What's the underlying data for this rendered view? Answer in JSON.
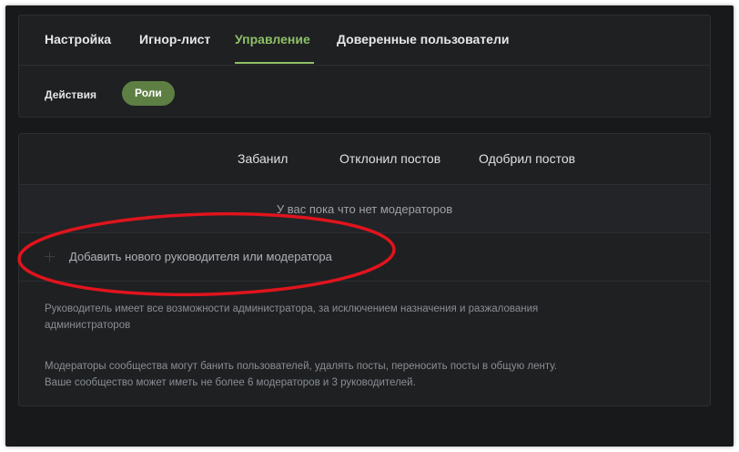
{
  "tabs": [
    {
      "label": "Настройка",
      "active": false
    },
    {
      "label": "Игнор-лист",
      "active": false
    },
    {
      "label": "Управление",
      "active": true
    },
    {
      "label": "Доверенные пользователи",
      "active": false
    }
  ],
  "subtabs": {
    "actions": "Действия",
    "roles": "Роли"
  },
  "table": {
    "columns": [
      "Забанил",
      "Отклонил постов",
      "Одобрил постов"
    ],
    "empty_message": "У вас пока что нет модераторов",
    "add_label": "Добавить нового руководителя или модератора"
  },
  "notes": {
    "leader_line1": "Руководитель имеет все возможности администратора, за исключением назначения и разжалования",
    "leader_line2": "администраторов",
    "moderator_line1": "Модераторы сообщества могут банить пользователей, удалять посты, переносить посты в общую ленту.",
    "moderator_line2": "Ваше сообщество может иметь не более 6 модераторов и 3 руководителей."
  },
  "colors": {
    "accent_green": "#8fbf67",
    "pill_green": "#5d7f43",
    "annotation_red": "#e0141c",
    "background": "#18191b"
  }
}
